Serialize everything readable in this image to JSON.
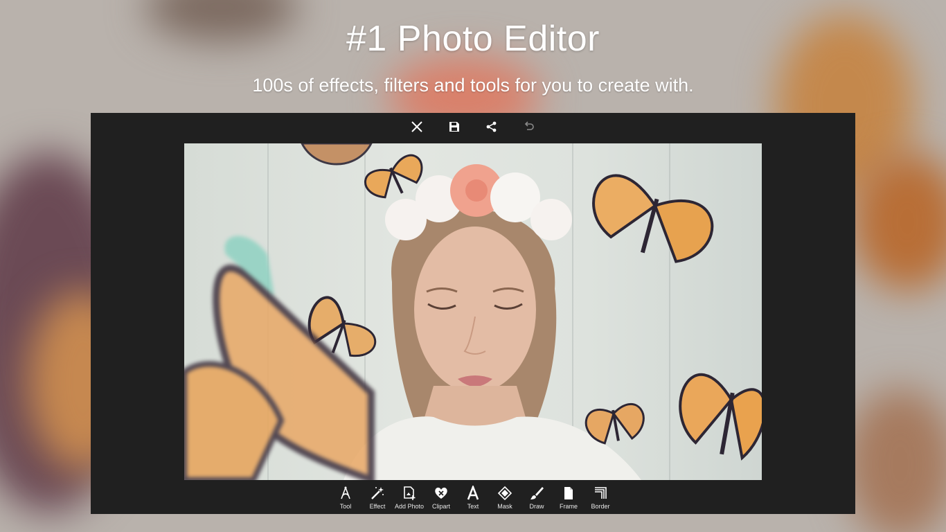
{
  "hero": {
    "title": "#1 Photo Editor",
    "subtitle": "100s of effects, filters and tools for you to create with."
  },
  "top_toolbar": {
    "icons": [
      "close-icon",
      "save-icon",
      "share-icon",
      "undo-icon"
    ]
  },
  "bottom_toolbar": {
    "tools": [
      {
        "label": "Tool",
        "icon": "compass-icon"
      },
      {
        "label": "Effect",
        "icon": "magic-wand-icon"
      },
      {
        "label": "Add Photo",
        "icon": "add-photo-icon"
      },
      {
        "label": "Clipart",
        "icon": "heart-icon"
      },
      {
        "label": "Text",
        "icon": "text-icon"
      },
      {
        "label": "Mask",
        "icon": "mask-icon"
      },
      {
        "label": "Draw",
        "icon": "brush-icon"
      },
      {
        "label": "Frame",
        "icon": "frame-icon"
      },
      {
        "label": "Border",
        "icon": "border-icon"
      }
    ]
  },
  "colors": {
    "window_bg": "#202020",
    "text": "#ffffff"
  }
}
